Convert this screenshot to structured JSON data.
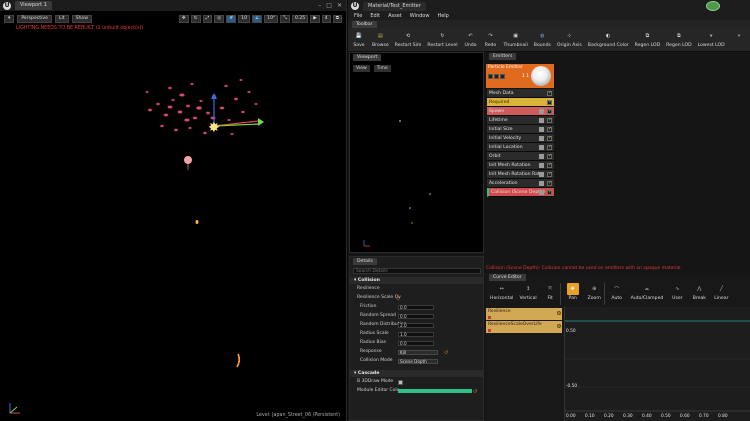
{
  "level_viewport": {
    "tab_title": "Viewport 1",
    "perspective_label": "Perspective",
    "lit_label": "Lit",
    "show_label": "Show",
    "grid_snap_value": "10",
    "rotation_snap_value": "10°",
    "scale_snap_value": "0.25",
    "camera_speed_value": "4",
    "lighting_warning": "LIGHTING NEEDS TO BE REBUILT (1 unbuilt object(s))",
    "level_label": "Level:  Japan_Street_06 (Persistent)",
    "window_controls": [
      "–",
      "□",
      "✕"
    ]
  },
  "cascade": {
    "tab_title": "Material/Test_Emitter",
    "menu": [
      "File",
      "Edit",
      "Asset",
      "Window",
      "Help"
    ],
    "tab_toolbar": "Toolbar",
    "toolbar": [
      {
        "label": "Save",
        "icon": "save-icon"
      },
      {
        "label": "Browse",
        "icon": "browse-icon"
      },
      {
        "label": "Restart Sim",
        "icon": "restart-sim-icon"
      },
      {
        "label": "Restart Level",
        "icon": "restart-level-icon"
      },
      {
        "label": "Undo",
        "icon": "undo-icon"
      },
      {
        "label": "Redo",
        "icon": "redo-icon"
      },
      {
        "label": "Thumbnail",
        "icon": "thumbnail-icon"
      },
      {
        "label": "Bounds",
        "icon": "bounds-icon"
      },
      {
        "label": "Origin Axis",
        "icon": "origin-axis-icon"
      },
      {
        "label": "Background Color",
        "icon": "background-color-icon"
      },
      {
        "label": "Regen LOD",
        "icon": "regen-lod-icon"
      },
      {
        "label": "Regen LOD",
        "icon": "regen-lod-icon"
      },
      {
        "label": "Lowest LOD",
        "icon": "lowest-lod-icon"
      }
    ],
    "viewport": {
      "tab": "Viewport",
      "view_btn": "View",
      "time_btn": "Time"
    },
    "emitters": {
      "tab": "Emitters",
      "emitter_name": "Particle Emitter",
      "emitter_count": "1 1",
      "modules": [
        {
          "label": "Mesh Data",
          "checked": true,
          "style": "plain"
        },
        {
          "label": "Required",
          "checked": true,
          "style": "required"
        },
        {
          "label": "Spawn",
          "checked": true,
          "style": "spawn"
        },
        {
          "label": "Lifetime",
          "checked": true,
          "style": "plain"
        },
        {
          "label": "Initial Size",
          "checked": true,
          "style": "plain"
        },
        {
          "label": "Initial Velocity",
          "checked": true,
          "style": "plain"
        },
        {
          "label": "Initial Location",
          "checked": true,
          "style": "plain"
        },
        {
          "label": "Orbit",
          "checked": true,
          "style": "plain"
        },
        {
          "label": "Init Mesh Rotation",
          "checked": true,
          "style": "plain"
        },
        {
          "label": "Init Mesh Rotation Rate",
          "checked": true,
          "style": "plain"
        },
        {
          "label": "Acceleration",
          "checked": true,
          "style": "plain"
        },
        {
          "label": "Collision (Scene Depth)",
          "checked": true,
          "style": "collision"
        }
      ]
    },
    "details": {
      "tab": "Details",
      "search_placeholder": "Search Details",
      "collision_header": "Collision",
      "rows_top": [
        {
          "label": "Resilience",
          "value": ""
        },
        {
          "label": "Resilience Scale Ov",
          "value": ""
        }
      ],
      "rows": [
        {
          "label": "Friction",
          "value": "0.0"
        },
        {
          "label": "Random Spread",
          "value": "0.0"
        },
        {
          "label": "Random Distribution",
          "value": "2.0"
        },
        {
          "label": "Radius Scale",
          "value": "1.0"
        },
        {
          "label": "Radius Bias",
          "value": "0.0"
        }
      ],
      "response_label": "Response",
      "response_value": "Kill",
      "collision_mode_label": "Collision Mode",
      "collision_mode_value": "Scene Depth",
      "cascade_header": "Cascade",
      "draw_mode_label": "B 3DDraw Mode",
      "module_color_label": "Module Editor Colo"
    },
    "error_message": "Collision (Scene Depth): Collision cannot be used on emitters with an opaque material",
    "curve_editor": {
      "tab": "Curve Editor",
      "tools": [
        {
          "label": "Horizontal",
          "icon": "horizontal-icon"
        },
        {
          "label": "Vertical",
          "icon": "vertical-icon"
        },
        {
          "label": "Fit",
          "icon": "fit-icon"
        },
        {
          "label": "Pan",
          "icon": "pan-icon"
        },
        {
          "label": "Zoom",
          "icon": "zoom-icon"
        },
        {
          "label": "Auto",
          "icon": "auto-icon"
        },
        {
          "label": "Auto/Clamped",
          "icon": "auto-clamped-icon"
        },
        {
          "label": "User",
          "icon": "user-icon"
        },
        {
          "label": "Break",
          "icon": "break-icon"
        },
        {
          "label": "Linear",
          "icon": "linear-icon"
        }
      ],
      "tracks": [
        "Resilience",
        "ResilienceScaleOverLife"
      ],
      "y_labels": [
        "0.50",
        "-0.50"
      ],
      "x_labels": [
        "0.00",
        "0.10",
        "0.20",
        "0.30",
        "0.40",
        "0.50",
        "0.60",
        "0.70",
        "0.80"
      ]
    }
  },
  "colors": {
    "accent_orange": "#e06a1e",
    "required_yellow": "#d8b43a",
    "spawn_red": "#cf5b5b",
    "collision_red": "#d24b4b",
    "warning_red": "#e23a3a",
    "curve_track": "#d3a855",
    "module_color_bar": "#2fc08a"
  }
}
